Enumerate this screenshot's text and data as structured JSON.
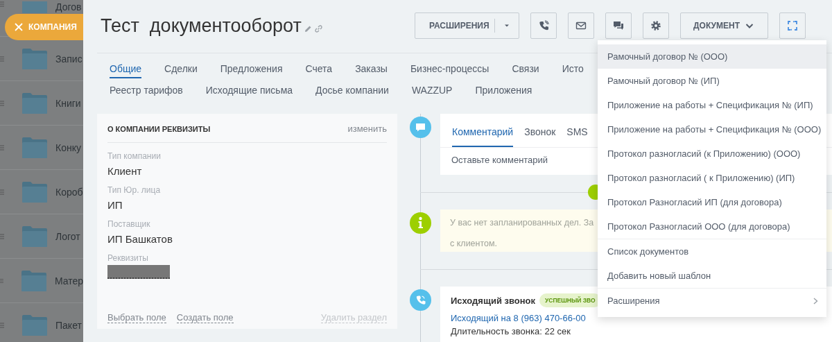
{
  "backdrop": {
    "folders": [
      {
        "name": "Догов"
      },
      {
        "name": "Запис"
      },
      {
        "name": "Книги"
      },
      {
        "name": "Конку"
      },
      {
        "name": "Короб"
      },
      {
        "name": "Логот"
      },
      {
        "name": "Матер"
      },
      {
        "name": "Пакет"
      }
    ]
  },
  "close_tab": {
    "label": "КОМПАНИЯ"
  },
  "title": "Тест  документооборот",
  "toolbar": {
    "extensions_button": "РАСШИРЕНИЯ",
    "document_button": "ДОКУМЕНТ"
  },
  "tabs": [
    [
      {
        "label": "Общие",
        "selected": true
      },
      {
        "label": "Сделки",
        "selected": false
      },
      {
        "label": "Предложения",
        "selected": false
      },
      {
        "label": "Счета",
        "selected": false
      },
      {
        "label": "Заказы",
        "selected": false
      },
      {
        "label": "Бизнес-процессы",
        "selected": false
      },
      {
        "label": "Связи",
        "selected": false
      },
      {
        "label": "Исто",
        "selected": false
      }
    ],
    [
      {
        "label": "Реестр тарифов",
        "selected": false
      },
      {
        "label": "Исходящие письма",
        "selected": false
      },
      {
        "label": "Досье компании",
        "selected": false
      },
      {
        "label": "WAZZUP",
        "selected": false
      },
      {
        "label": "Приложения",
        "selected": false
      }
    ]
  ],
  "details_card": {
    "title": "О КОМПАНИИ РЕКВИЗИТЫ",
    "edit_link": "изменить",
    "fields": [
      {
        "kind": "text",
        "label": "Тип компании",
        "value": "Клиент"
      },
      {
        "kind": "text",
        "label": "Тип Юр. лица",
        "value": "ИП"
      },
      {
        "kind": "text",
        "label": "Поставщик",
        "value": "ИП Башкатов"
      },
      {
        "kind": "redacted",
        "label": "Реквизиты"
      }
    ],
    "footer_links": [
      "Выбрать поле",
      "Создать поле"
    ],
    "delete_link": "Удалить раздел"
  },
  "timeline": {
    "composer": {
      "tabs": [
        {
          "label": "Комментарий",
          "selected": true
        },
        {
          "label": "Звонок",
          "selected": false
        },
        {
          "label": "SMS",
          "selected": false
        }
      ],
      "placeholder": "Оставьте комментарий"
    },
    "notice": {
      "text": "У вас нет запланированных дел. За\nс клиентом."
    },
    "call": {
      "title": "Исходящий звонок",
      "badge": "УСПЕШНЫЙ ЗВО",
      "link": "Исходящий на 8 (963) 470-66-00",
      "duration": "Длительность звонка: 22 сек"
    }
  },
  "dropdown": {
    "sections": [
      [
        {
          "label": "Рамочный договор № (ООО)",
          "kind": "item",
          "selected": true
        },
        {
          "label": "Рамочный договор № (ИП)",
          "kind": "item",
          "selected": false
        },
        {
          "label": "Приложение на работы + Спецификация № (ИП)",
          "kind": "item",
          "selected": false
        },
        {
          "label": "Приложение на работы + Спецификация № (ООО)",
          "kind": "item",
          "selected": false
        },
        {
          "label": "Протокол разногласий (к Приложению) (ООО)",
          "kind": "item",
          "selected": false
        },
        {
          "label": "Протокол разногласий ( к Приложению) (ИП)",
          "kind": "item",
          "selected": false
        },
        {
          "label": "Протокол Разногласий ИП (для договора)",
          "kind": "item",
          "selected": false
        },
        {
          "label": "Протокол Разногласий ООО (для договора)",
          "kind": "item",
          "selected": false
        }
      ],
      [
        {
          "label": "Список документов",
          "kind": "item",
          "selected": false
        },
        {
          "label": "Добавить новый шаблон",
          "kind": "item",
          "selected": false
        }
      ],
      [
        {
          "label": "Расширения",
          "kind": "submenu",
          "selected": false
        }
      ]
    ]
  }
}
